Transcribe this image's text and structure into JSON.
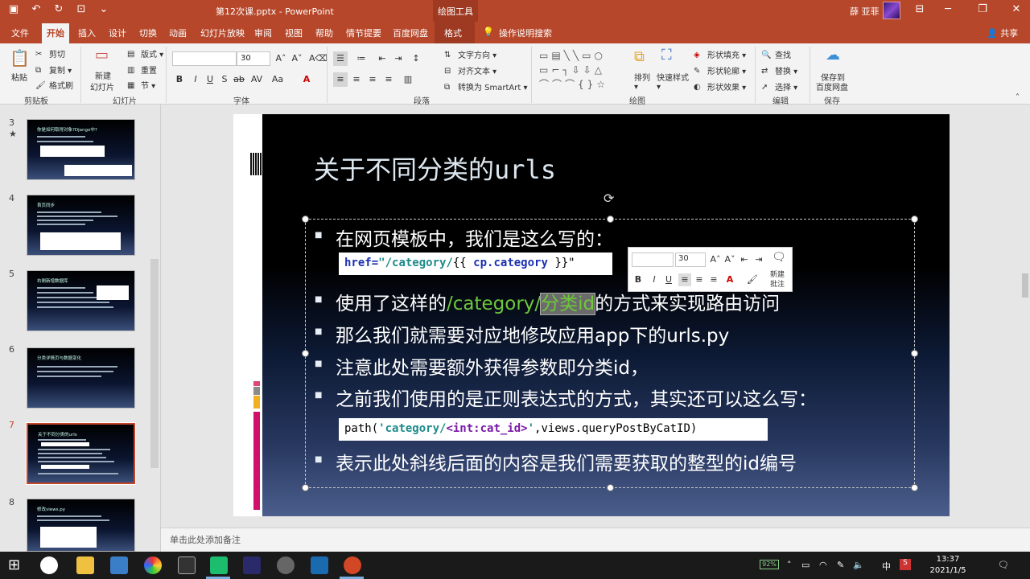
{
  "titlebar": {
    "doc_title": "第12次课.pptx - PowerPoint",
    "context_tools": "绘图工具",
    "user": "薛 亚菲"
  },
  "tabs": {
    "file": "文件",
    "home": "开始",
    "insert": "插入",
    "design": "设计",
    "transitions": "切换",
    "animations": "动画",
    "slideshow": "幻灯片放映",
    "review": "审阅",
    "view": "视图",
    "help": "帮助",
    "qingtang": "情节提要",
    "baidu": "百度网盘",
    "format": "格式",
    "tellme": "操作说明搜索",
    "share": "共享"
  },
  "ribbon": {
    "paste": "粘贴",
    "cut": "剪切",
    "copy": "复制",
    "format_painter": "格式刷",
    "clipboard": "剪贴板",
    "new_slide": "新建",
    "new_slide2": "幻灯片",
    "layout": "版式",
    "reset": "重置",
    "section": "节",
    "slides": "幻灯片",
    "font_size": "30",
    "font_group": "字体",
    "text_direction": "文字方向",
    "align_text": "对齐文本",
    "smartart": "转换为 SmartArt",
    "paragraph": "段落",
    "arrange": "排列",
    "quick_styles": "快速样式",
    "shape_fill": "形状填充",
    "shape_outline": "形状轮廓",
    "shape_effects": "形状效果",
    "drawing": "绘图",
    "find": "查找",
    "replace": "替换",
    "select": "选择",
    "editing": "编辑",
    "save_to_baidu": "保存到",
    "save_to_baidu2": "百度网盘",
    "save_group": "保存"
  },
  "thumbs": [
    {
      "num": "3",
      "title": "你是如何取得对象?Django中?",
      "star": "★"
    },
    {
      "num": "4",
      "title": "首页同步"
    },
    {
      "num": "5",
      "title": "右侧新增数据库"
    },
    {
      "num": "6",
      "title": "分类详情页与数据变化"
    },
    {
      "num": "7",
      "title": "关于不同分类的urls"
    },
    {
      "num": "8",
      "title": "修改views.py"
    }
  ],
  "slide": {
    "title": "关于不同分类的urls",
    "b1": "在网页模板中，我们是这么写的：",
    "code1_a": "href=",
    "code1_b": "\"/category/",
    "code1_c": "{{ ",
    "code1_d": "cp.category",
    "code1_e": " }}\"",
    "b2_a": "使用了这样的",
    "b2_b": "/category/",
    "b2_c": "分类id",
    "b2_d": "的方式来实现路由访问",
    "b3": "那么我们就需要对应地修改应用app下的urls.py",
    "b4": "注意此处需要额外获得参数即分类id，",
    "b5": "之前我们使用的是正则表达式的方式，其实还可以这么写：",
    "code2_a": "path(",
    "code2_b": "'category/",
    "code2_c": "<int:cat_id>",
    "code2_d": "'",
    "code2_e": ",views.queryPostByCatID)",
    "b6": "表示此处斜线后面的内容是我们需要获取的整型的id编号"
  },
  "mini": {
    "size": "30",
    "new_comment": "新建",
    "new_comment2": "批注"
  },
  "notes": {
    "placeholder": "单击此处添加备注"
  },
  "taskbar": {
    "battery": "92%",
    "ime": "中",
    "time": "13:37",
    "date": "2021/1/5"
  },
  "colors": {
    "accent": "#b7472a",
    "green": "#6ec83a"
  }
}
